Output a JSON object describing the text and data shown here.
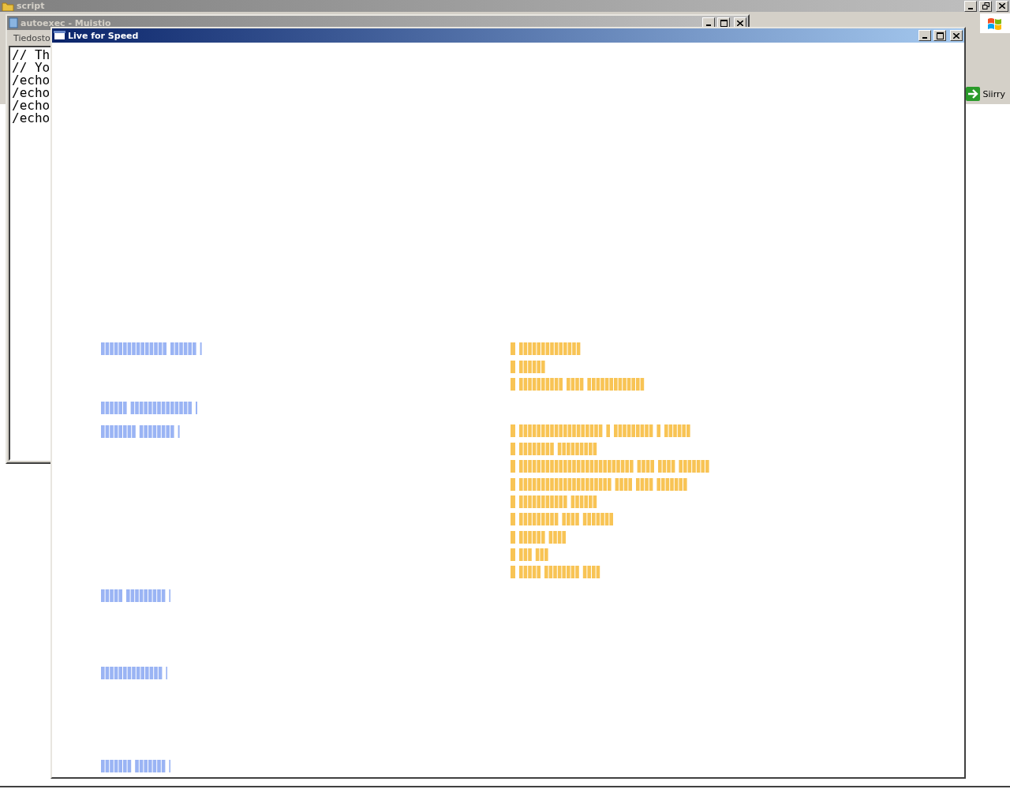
{
  "explorer_window": {
    "title": "script",
    "active": false,
    "go_button": "Siirry"
  },
  "notepad_window": {
    "title": "autoexec - Muistio",
    "active": false,
    "menu": [
      "Tiedosto"
    ],
    "lines": [
      "// Th",
      "// Yo",
      "/echo",
      "/echo",
      "/echo",
      "/echo"
    ]
  },
  "game_window": {
    "title": "Live for Speed",
    "active": true,
    "left_lines": [
      {
        "kind": "label"
      },
      {
        "kind": "label"
      },
      {
        "kind": "label"
      },
      {
        "kind": "label"
      },
      {
        "kind": "label"
      },
      {
        "kind": "label"
      }
    ],
    "right_lines": [
      {
        "kind": "bullet"
      },
      {
        "kind": "bullet"
      },
      {
        "kind": "bullet"
      },
      {
        "kind": "bullet"
      },
      {
        "kind": "bullet"
      },
      {
        "kind": "bullet"
      },
      {
        "kind": "bullet"
      },
      {
        "kind": "bullet"
      },
      {
        "kind": "bullet"
      },
      {
        "kind": "bullet"
      },
      {
        "kind": "bullet"
      },
      {
        "kind": "bullet"
      }
    ]
  }
}
